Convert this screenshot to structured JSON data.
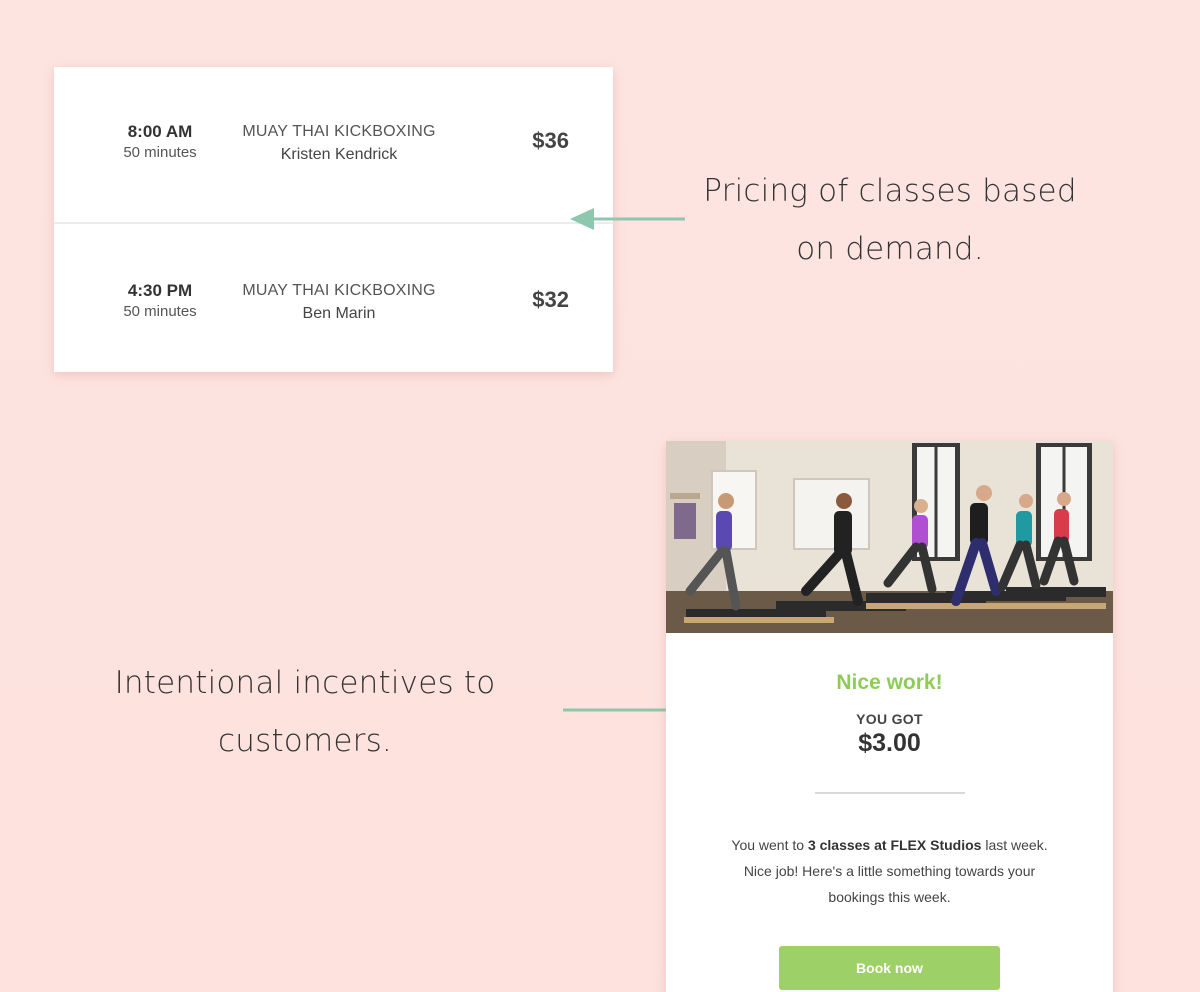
{
  "schedule": {
    "classes": [
      {
        "time": "8:00 AM",
        "duration": "50 minutes",
        "name": "MUAY THAI KICKBOXING",
        "instructor": "Kristen Kendrick",
        "price": "$36"
      },
      {
        "time": "4:30 PM",
        "duration": "50 minutes",
        "name": "MUAY THAI KICKBOXING",
        "instructor": "Ben Marin",
        "price": "$32"
      }
    ]
  },
  "annotations": {
    "pricing_line1": "Pricing of classes based",
    "pricing_line2": "on demand.",
    "incentive_line1": "Intentional incentives to",
    "incentive_line2": "customers."
  },
  "email": {
    "headline": "Nice work!",
    "you_got": "YOU GOT",
    "amount": "$3.00",
    "message_prefix": "You went to ",
    "message_bold": "3 classes at FLEX Studios",
    "message_suffix": " last week. Nice job! Here's a little something towards your bookings this week.",
    "button_label": "Book now"
  },
  "colors": {
    "background": "#fde3e0",
    "arrow": "#8cc7ae",
    "headline_green": "#8fcc55",
    "button_green": "#9ed068"
  }
}
